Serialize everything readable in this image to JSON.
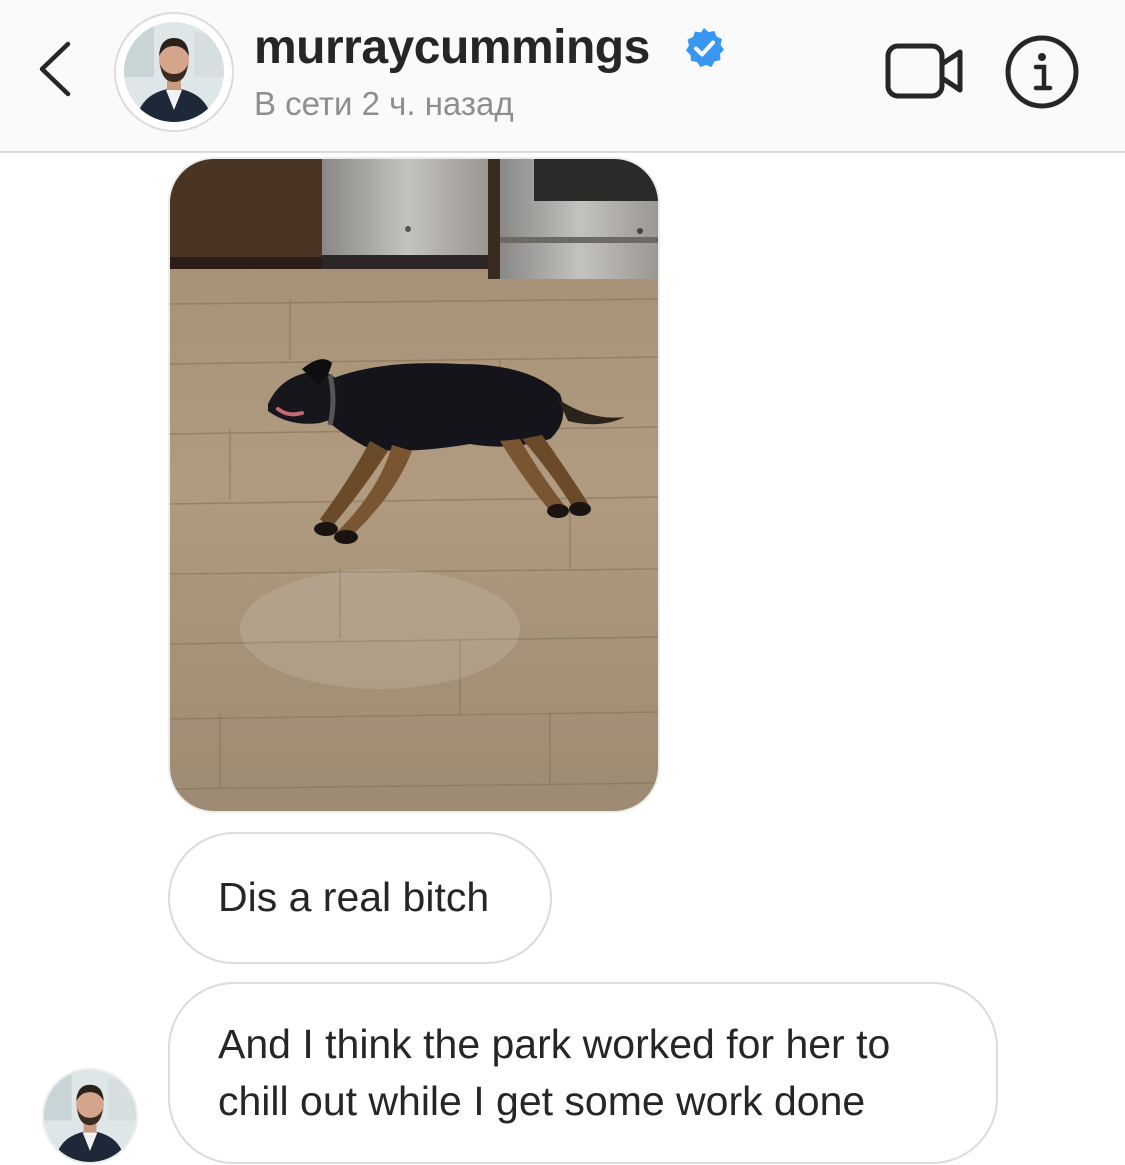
{
  "header": {
    "username": "murraycummings",
    "status": "В сети 2 ч. назад",
    "verified_color": "#3897f0",
    "icons": {
      "back": "chevron-left-icon",
      "verified": "verified-badge-icon",
      "video": "video-camera-icon",
      "info": "info-icon"
    }
  },
  "messages": [
    {
      "type": "photo",
      "description": "dog-on-floor-photo"
    },
    {
      "type": "text",
      "text": "Dis a real bitch"
    },
    {
      "type": "text",
      "lines": [
        "And I think the park worked for her to",
        "chill out while I get some work done"
      ]
    }
  ],
  "colors": {
    "header_bg": "#fafafa",
    "border": "#dbdbdb",
    "text": "#262626",
    "secondary_text": "#8e8e8e"
  }
}
